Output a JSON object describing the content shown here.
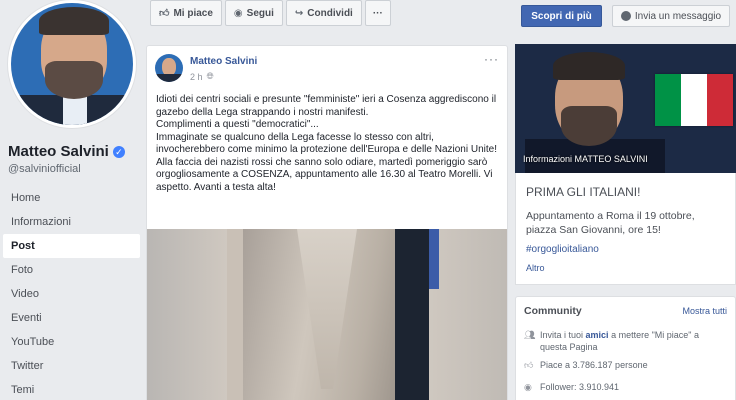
{
  "profile": {
    "name": "Matteo Salvini",
    "handle": "@salviniofficial"
  },
  "nav": {
    "items": [
      "Home",
      "Informazioni",
      "Post",
      "Foto",
      "Video",
      "Eventi",
      "YouTube",
      "Twitter",
      "Temi"
    ],
    "active": "Post"
  },
  "actions": {
    "like": "Mi piace",
    "follow": "Segui",
    "share": "Condividi",
    "more": "···"
  },
  "cta": {
    "learn_more": "Scopri di più",
    "send_message": "Invia un messaggio"
  },
  "post": {
    "author": "Matteo Salvini",
    "time": "2 h",
    "more": "···",
    "text": [
      "Idioti dei centri sociali e presunte \"femministe\" ieri a Cosenza aggrediscono il gazebo della Lega strappando i nostri manifesti.",
      "Complimenti a questi \"democratici\"...",
      "Immaginate se qualcuno della Lega facesse lo stesso con altri, invocherebbero come minimo la protezione dell'Europa e delle Nazioni Unite!",
      "Alla faccia dei nazisti rossi che sanno solo odiare, martedì pomeriggio sarò orgogliosamente a COSENZA, appuntamento alle 16.30 al Teatro Morelli. Vi aspetto. Avanti a testa alta!"
    ]
  },
  "cover": {
    "caption": "Informazioni MATTEO SALVINI"
  },
  "info": {
    "title": "PRIMA GLI ITALIANI!",
    "body": "Appuntamento a Roma il 19 ottobre, piazza San Giovanni, ore 15!",
    "tag": "#orgoglioitaliano",
    "more": "Altro"
  },
  "community": {
    "title": "Community",
    "see_all": "Mostra tutti",
    "invite_prefix": "Invita i tuoi",
    "invite_link": "amici",
    "invite_suffix": "a mettere \"Mi piace\" a questa Pagina",
    "likes": "Piace a 3.786.187 persone",
    "followers": "Follower: 3.910.941"
  },
  "colors": {
    "brand": "#4267b2",
    "link": "#385898",
    "flag_green": "#009246",
    "flag_white": "#ffffff",
    "flag_red": "#ce2b37"
  }
}
